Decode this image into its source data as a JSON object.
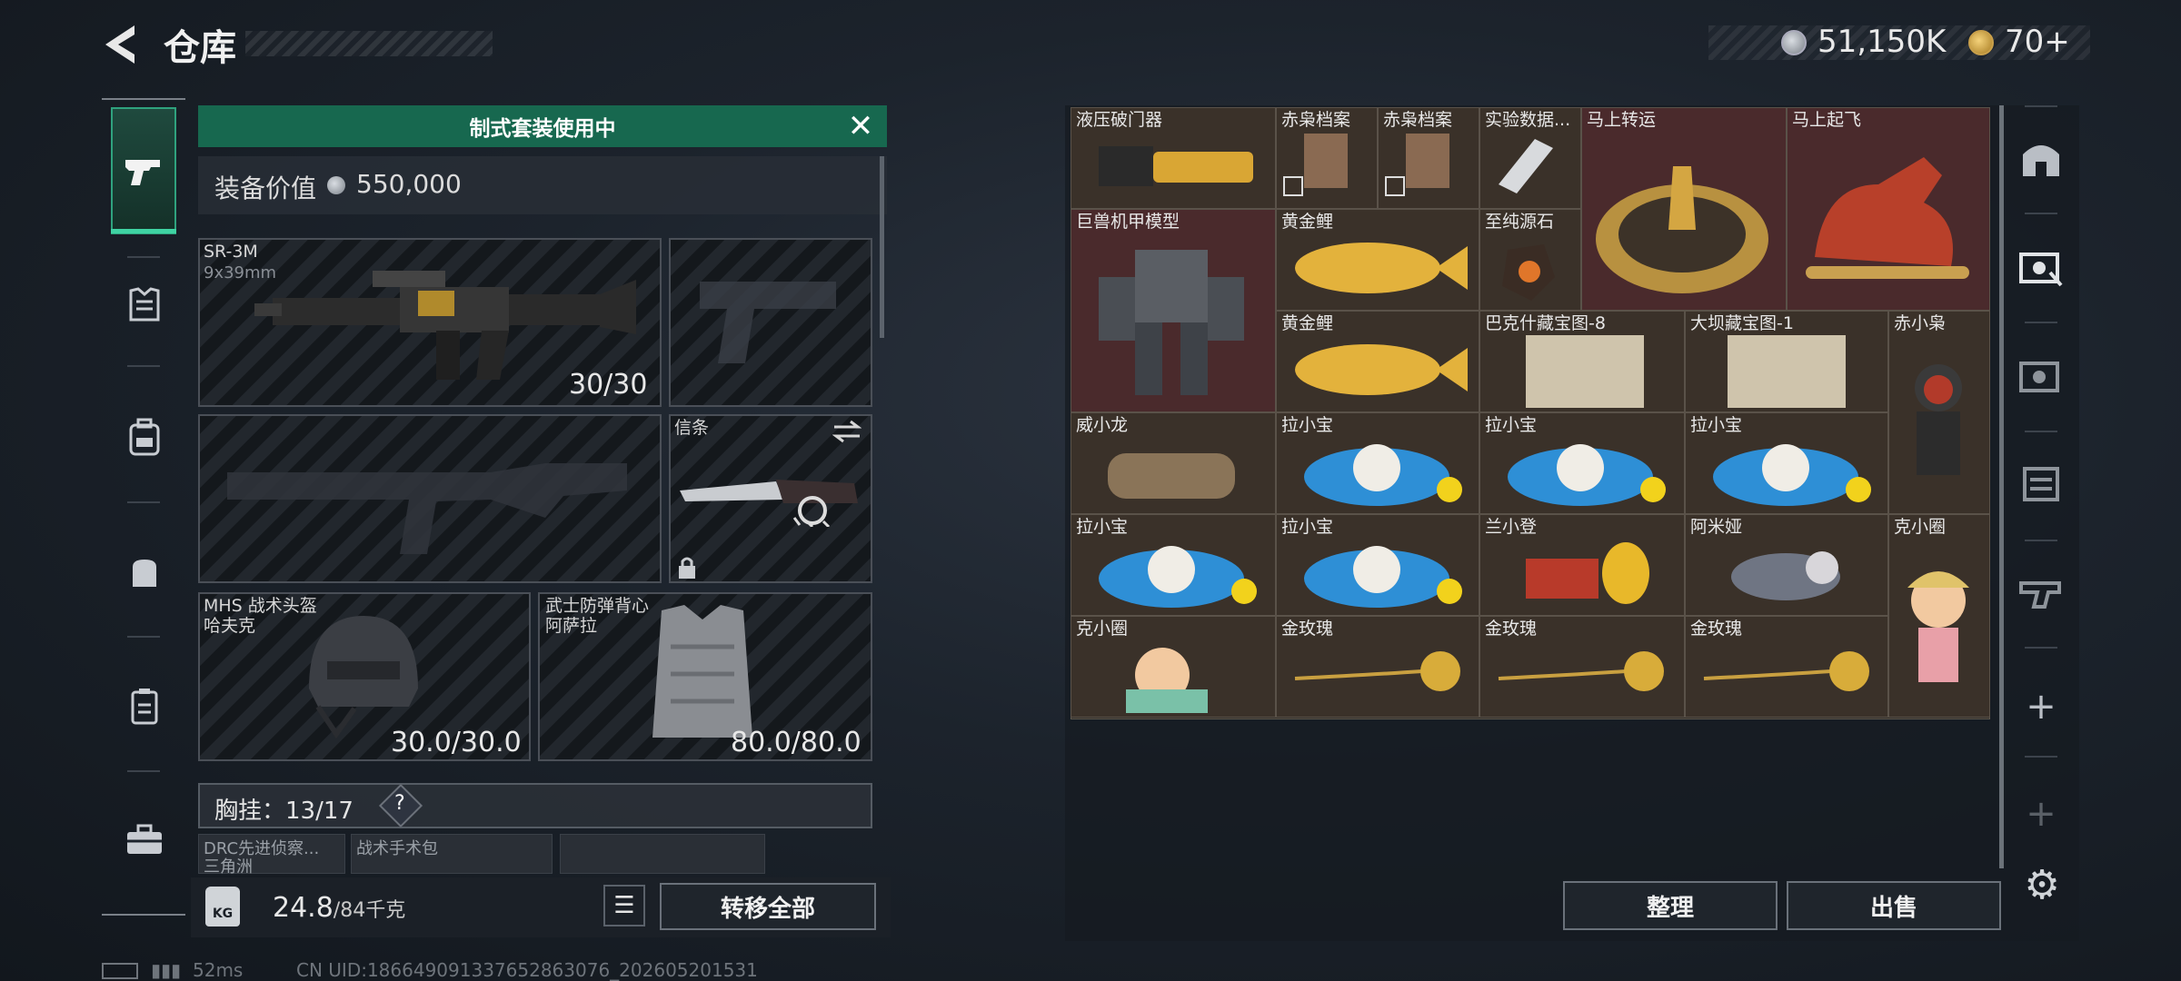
{
  "header": {
    "title": "仓库",
    "silver_amount": "51,150K",
    "gold_amount": "70+"
  },
  "loadout": {
    "suit_banner": "制式套装使用中",
    "equip_value_label": "装备价值",
    "equip_value": "550,000",
    "primary": {
      "name": "SR-3M",
      "ammo": "9x39mm",
      "count": "30/30"
    },
    "melee": {
      "name": "信条"
    },
    "helmet": {
      "name": "MHS 战术头盔",
      "sub": "哈夫克",
      "durability": "30.0/30.0"
    },
    "armor": {
      "name": "武士防弹背心",
      "sub": "阿萨拉",
      "durability": "80.0/80.0"
    },
    "chest_rig": {
      "label": "胸挂：",
      "value": "13/17",
      "help": "?"
    },
    "mini_items": [
      "DRC先进侦察...",
      "三角洲",
      "战术手术包"
    ]
  },
  "bottom": {
    "kg": "KG",
    "weight_current": "24.8",
    "weight_max": "/84千克",
    "transfer_all": "转移全部"
  },
  "status": {
    "ping": "52ms",
    "uid": "CN UID:18664909133765286307​6_202605201531"
  },
  "stash": {
    "cells": [
      {
        "name": "液压破门器"
      },
      {
        "name": "赤枭档案"
      },
      {
        "name": "赤枭档案"
      },
      {
        "name": "实验数据..."
      },
      {
        "name": "马上转运"
      },
      {
        "name": "马上起飞"
      },
      {
        "name": "巨兽机甲模型"
      },
      {
        "name": "黄金鲤"
      },
      {
        "name": "至纯源石"
      },
      {
        "name": "黄金鲤"
      },
      {
        "name": "巴克什藏宝图-8"
      },
      {
        "name": "大坝藏宝图-1"
      },
      {
        "name": "赤小枭"
      },
      {
        "name": "威小龙"
      },
      {
        "name": "拉小宝"
      },
      {
        "name": "拉小宝"
      },
      {
        "name": "拉小宝"
      },
      {
        "name": "拉小宝"
      },
      {
        "name": "拉小宝"
      },
      {
        "name": "兰小登"
      },
      {
        "name": "阿米娅"
      },
      {
        "name": "克小圈"
      },
      {
        "name": "克小圈"
      },
      {
        "name": "金玫瑰"
      },
      {
        "name": "金玫瑰"
      },
      {
        "name": "金玫瑰"
      }
    ],
    "sort_label": "整理",
    "sell_label": "出售"
  },
  "side_icons": [
    "vault-icon",
    "stash-tab-icon",
    "stash-tab-2-icon",
    "stash-tab-3-icon",
    "stash-tab-4-icon",
    "add-icon",
    "add-2-icon",
    "settings-icon"
  ]
}
